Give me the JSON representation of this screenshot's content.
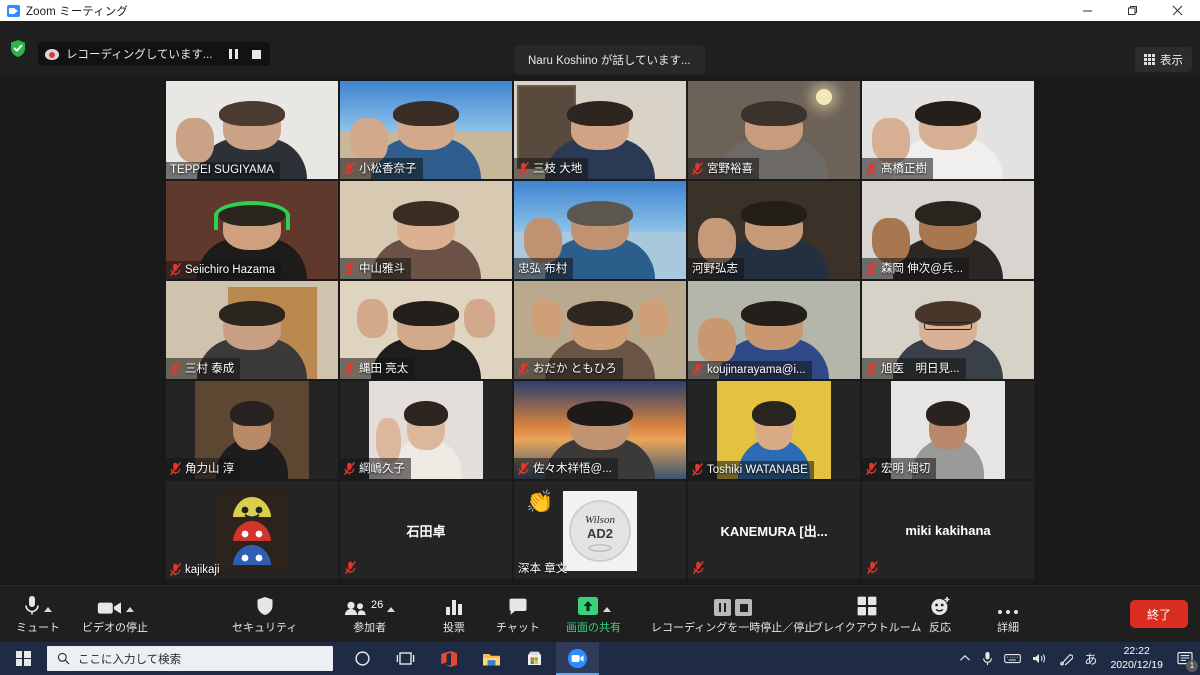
{
  "window": {
    "title": "Zoom ミーティング",
    "app_icon": "zoom-video-icon",
    "minimize_label": "—",
    "restore_label": "❐",
    "close_label": "✕"
  },
  "header": {
    "shield_icon": "security-shield-icon",
    "recording_icon": "recording-indicator-icon",
    "recording_text": "レコーディングしています...",
    "pause_icon": "pause-icon",
    "stop_icon": "stop-icon",
    "speaking_text": "Naru  Koshino が話しています...",
    "view_icon": "grid-view-icon",
    "view_label": "表示"
  },
  "grid": {
    "columns": 5,
    "rows": 5,
    "mute_icon": "muted-microphone-icon",
    "participants": [
      {
        "name": "TEPPEI SUGIYAMA",
        "muted": false,
        "video": true,
        "kind": "photo",
        "scene": "p1"
      },
      {
        "name": "小松香奈子",
        "muted": true,
        "video": true,
        "kind": "photo",
        "scene": "p2"
      },
      {
        "name": "三枝 大地",
        "muted": true,
        "video": true,
        "kind": "photo",
        "scene": "p3"
      },
      {
        "name": "宮野裕喜",
        "muted": true,
        "video": true,
        "kind": "photo",
        "scene": "p4"
      },
      {
        "name": "髙橋正樹",
        "muted": true,
        "video": true,
        "kind": "photo",
        "scene": "p5"
      },
      {
        "name": "Seiichiro Hazama",
        "muted": true,
        "video": true,
        "kind": "photo",
        "scene": "p6"
      },
      {
        "name": "中山雅斗",
        "muted": true,
        "video": true,
        "kind": "photo",
        "scene": "p7"
      },
      {
        "name": "忠弘 布村",
        "muted": false,
        "video": true,
        "kind": "photo",
        "scene": "p8"
      },
      {
        "name": "河野弘志",
        "muted": false,
        "video": true,
        "kind": "photo",
        "scene": "p9"
      },
      {
        "name": "森岡 伸次@兵...",
        "muted": true,
        "video": true,
        "kind": "photo",
        "scene": "p10"
      },
      {
        "name": "三村 泰成",
        "muted": true,
        "video": true,
        "kind": "photo",
        "scene": "p11"
      },
      {
        "name": "縄田 亮太",
        "muted": true,
        "video": true,
        "kind": "photo",
        "scene": "p12"
      },
      {
        "name": "おだか ともひろ",
        "muted": true,
        "video": true,
        "kind": "photo",
        "scene": "p13"
      },
      {
        "name": "koujinarayama@i...",
        "muted": true,
        "video": true,
        "kind": "photo",
        "scene": "p14"
      },
      {
        "name": "旭医　明日見...",
        "muted": true,
        "video": true,
        "kind": "photo",
        "scene": "p15"
      },
      {
        "name": "角力山 淳",
        "muted": true,
        "video": true,
        "kind": "photo-narrow",
        "scene": "p16"
      },
      {
        "name": "綱嶋久子",
        "muted": true,
        "video": true,
        "kind": "photo-narrow",
        "scene": "p17"
      },
      {
        "name": "佐々木祥悟@...",
        "muted": true,
        "video": true,
        "kind": "photo",
        "scene": "p18"
      },
      {
        "name": "Toshiki WATANABE",
        "muted": true,
        "video": true,
        "kind": "photo-narrow",
        "scene": "p19"
      },
      {
        "name": "宏明 堀切",
        "muted": true,
        "video": true,
        "kind": "photo-narrow",
        "scene": "p20"
      },
      {
        "name": "kajikaji",
        "muted": true,
        "video": false,
        "kind": "avatar",
        "scene": "slime-avatar"
      },
      {
        "name": "石田卓",
        "muted": true,
        "video": false,
        "kind": "name-only",
        "scene": ""
      },
      {
        "name": "深本 章文",
        "muted": false,
        "video": false,
        "kind": "avatar-react",
        "scene": "wilson-ball-avatar",
        "reaction": "👏"
      },
      {
        "name": "KANEMURA [出...",
        "muted": true,
        "video": false,
        "kind": "name-only",
        "scene": ""
      },
      {
        "name": "miki kakihana",
        "muted": true,
        "video": false,
        "kind": "name-only",
        "scene": ""
      }
    ]
  },
  "toolbar": {
    "items": [
      {
        "label": "ミュート",
        "icon": "microphone-icon",
        "caret": true,
        "accent": ""
      },
      {
        "label": "ビデオの停止",
        "icon": "video-camera-icon",
        "caret": true,
        "accent": ""
      },
      {
        "label": "セキュリティ",
        "icon": "shield-icon",
        "caret": false,
        "accent": ""
      },
      {
        "label": "参加者",
        "icon": "participants-icon",
        "caret": true,
        "accent": "",
        "count": "26"
      },
      {
        "label": "投票",
        "icon": "poll-bars-icon",
        "caret": false,
        "accent": ""
      },
      {
        "label": "チャット",
        "icon": "chat-bubble-icon",
        "caret": false,
        "accent": ""
      },
      {
        "label": "画面の共有",
        "icon": "share-screen-icon",
        "caret": true,
        "accent": "green"
      },
      {
        "label": "レコーディングを一時停止／停止",
        "icon": "recording-pause-stop-icon",
        "caret": false,
        "accent": ""
      },
      {
        "label": "ブレイクアウトルーム",
        "icon": "breakout-rooms-icon",
        "caret": false,
        "accent": ""
      },
      {
        "label": "反応",
        "icon": "reactions-smiley-icon",
        "caret": false,
        "accent": ""
      },
      {
        "label": "詳細",
        "icon": "more-ellipsis-icon",
        "caret": false,
        "accent": ""
      }
    ],
    "end_label": "終了",
    "share_color": "#3ad17a",
    "end_color": "#d92d20"
  },
  "taskbar": {
    "start_icon": "windows-start-icon",
    "search_icon": "search-icon",
    "search_placeholder": "ここに入力して検索",
    "apps": [
      {
        "icon": "cortana-circle-icon",
        "active": false
      },
      {
        "icon": "task-view-icon",
        "active": false
      },
      {
        "icon": "office-icon",
        "active": false
      },
      {
        "icon": "file-explorer-icon",
        "active": false
      },
      {
        "icon": "microsoft-store-icon",
        "active": false
      },
      {
        "icon": "zoom-app-icon",
        "active": true
      }
    ],
    "tray": [
      {
        "icon": "chevron-up-icon",
        "glyph": "∧"
      },
      {
        "icon": "microphone-tray-icon",
        "glyph": ""
      },
      {
        "icon": "keyboard-tray-icon",
        "glyph": ""
      },
      {
        "icon": "volume-tray-icon",
        "glyph": ""
      },
      {
        "icon": "bluetooth-clip-icon",
        "glyph": ""
      },
      {
        "icon": "ime-mode-icon",
        "glyph": "あ"
      }
    ],
    "time": "22:22",
    "date": "2020/12/19",
    "notification_icon": "notification-icon",
    "notification_count": "1"
  }
}
